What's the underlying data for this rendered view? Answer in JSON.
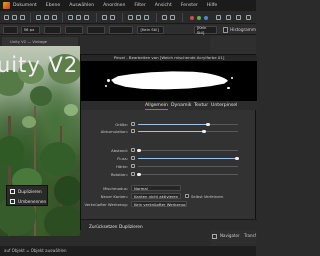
{
  "menubar": {
    "items": [
      "Dokument",
      "Ebene",
      "Auswählen",
      "Anordnen",
      "Filter",
      "Ansicht",
      "Fenster",
      "Hilfe"
    ]
  },
  "context_bar": {
    "size_value": "56 px",
    "brush_preset": "[Kein Stil]",
    "brush_preset_right": "[Kein Stil]",
    "histogram_label": "Histogramm"
  },
  "document_tab": {
    "title": "Unity V2 — Vintage"
  },
  "canvas": {
    "overlay_text": "uity V2"
  },
  "context_menu": {
    "items": [
      {
        "icon": "duplicate-icon",
        "label": "Duplizieren"
      },
      {
        "icon": "rename-icon",
        "label": "Umbenennen"
      }
    ]
  },
  "dialog": {
    "title": "Pinsel - Bearbeiten von [Weich mischende Acrylfarbe 01]",
    "tabs": [
      "Allgemein",
      "Dynamik",
      "Textur",
      "Unterpinsel"
    ],
    "active_tab": "Allgemein",
    "sliders": [
      {
        "label": "Größe:",
        "value": ""
      },
      {
        "label": "Akkumulation:",
        "value": ""
      },
      {
        "label": "Abstand:",
        "value": ""
      },
      {
        "label": "Fluss:",
        "value": ""
      },
      {
        "label": "Härte:",
        "value": ""
      },
      {
        "label": "Rotation:",
        "value": ""
      },
      {
        "label": "Form:",
        "value": ""
      },
      {
        "label": "Rotation:",
        "value": ""
      }
    ],
    "blend_mode_label": "Mischmodus:",
    "blend_mode_value": "Normal",
    "nozzle_label": "Neuer Kanten:",
    "nozzle_value": "Kanten nicht aktivieren",
    "checkbox_label": "Selbst Verfeinern",
    "wet_edges_label": "Verknüpfter Werkzeug:",
    "wet_edges_value": "Kein verknüpfter Werkzeug",
    "buttons": {
      "reset": "Zurücksetzen",
      "duplicate": "Duplizieren"
    }
  },
  "right_panel": {
    "navigator_label": "Navigator",
    "transform_label": "Transf"
  },
  "status_bar": {
    "text": "auf Objekt = Objekt auswählen"
  }
}
